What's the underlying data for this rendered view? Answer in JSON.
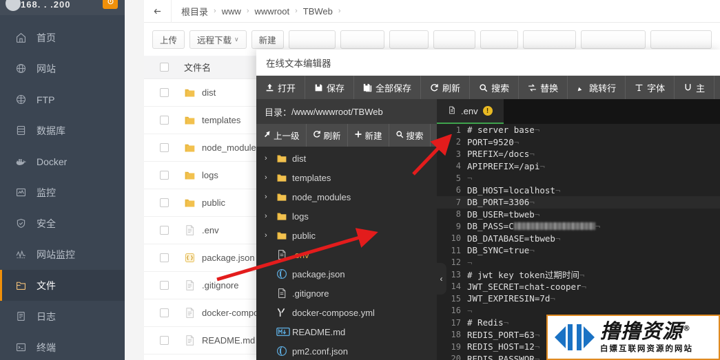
{
  "sidebar": {
    "server_ip": "168.    .      .200",
    "power_icon": "power-icon",
    "items": [
      {
        "label": "首页",
        "icon": "home-icon",
        "active": false
      },
      {
        "label": "网站",
        "icon": "globe-icon",
        "active": false
      },
      {
        "label": "FTP",
        "icon": "ftp-icon",
        "active": false
      },
      {
        "label": "数据库",
        "icon": "database-icon",
        "active": false
      },
      {
        "label": "Docker",
        "icon": "docker-icon",
        "active": false
      },
      {
        "label": "监控",
        "icon": "monitor-icon",
        "active": false
      },
      {
        "label": "安全",
        "icon": "shield-icon",
        "active": false
      },
      {
        "label": "网站监控",
        "icon": "pulse-icon",
        "active": false
      },
      {
        "label": "文件",
        "icon": "folder-icon",
        "active": true
      },
      {
        "label": "日志",
        "icon": "log-icon",
        "active": false
      },
      {
        "label": "终端",
        "icon": "terminal-icon",
        "active": false
      }
    ]
  },
  "filemanager": {
    "back_icon": "back-arrow-icon",
    "breadcrumb": [
      "根目录",
      "www",
      "wwwroot",
      "TBWeb"
    ],
    "breadcrumb_separator": "›",
    "toolbar": [
      {
        "label": "上传",
        "caret": ""
      },
      {
        "label": "远程下载",
        "caret": "∨"
      },
      {
        "label": "新建",
        "caret": ""
      }
    ],
    "table": {
      "header_checkbox": "select-all-checkbox",
      "columns": [
        "文件名"
      ],
      "rows": [
        {
          "name": "dist",
          "type": "folder"
        },
        {
          "name": "templates",
          "type": "folder"
        },
        {
          "name": "node_modules",
          "type": "folder"
        },
        {
          "name": "logs",
          "type": "folder"
        },
        {
          "name": "public",
          "type": "folder"
        },
        {
          "name": ".env",
          "type": "file"
        },
        {
          "name": "package.json",
          "type": "json"
        },
        {
          "name": ".gitignore",
          "type": "file"
        },
        {
          "name": "docker-compose.yml",
          "type": "file"
        },
        {
          "name": "README.md",
          "type": "file"
        }
      ]
    }
  },
  "editor": {
    "title": "在线文本编辑器",
    "toolbar": [
      {
        "label": "打开",
        "icon": "upload-icon"
      },
      {
        "label": "保存",
        "icon": "save-icon"
      },
      {
        "label": "全部保存",
        "icon": "save-all-icon"
      },
      {
        "label": "刷新",
        "icon": "refresh-icon"
      },
      {
        "label": "搜索",
        "icon": "search-icon"
      },
      {
        "label": "替换",
        "icon": "replace-icon"
      },
      {
        "label": "跳转行",
        "icon": "goto-line-icon"
      },
      {
        "label": "字体",
        "icon": "font-icon"
      },
      {
        "label": "主",
        "icon": "theme-icon"
      }
    ],
    "directory_label": "目录：",
    "directory_path": "/www/wwwroot/TBWeb",
    "left_toolbar": [
      {
        "label": "上一级",
        "icon": "up-level-icon"
      },
      {
        "label": "刷新",
        "icon": "refresh-icon"
      },
      {
        "label": "新建",
        "icon": "plus-icon"
      },
      {
        "label": "搜索",
        "icon": "search-icon"
      }
    ],
    "tree": [
      {
        "name": "dist",
        "type": "folder",
        "expandable": true,
        "highlight": false
      },
      {
        "name": "templates",
        "type": "folder",
        "expandable": true,
        "highlight": false
      },
      {
        "name": "node_modules",
        "type": "folder",
        "expandable": true,
        "highlight": false
      },
      {
        "name": "logs",
        "type": "folder",
        "expandable": true,
        "highlight": false
      },
      {
        "name": "public",
        "type": "folder",
        "expandable": true,
        "highlight": false
      },
      {
        "name": ".env",
        "type": "file",
        "expandable": false,
        "highlight": true
      },
      {
        "name": "package.json",
        "type": "json",
        "expandable": false,
        "highlight": false
      },
      {
        "name": ".gitignore",
        "type": "file",
        "expandable": false,
        "highlight": false
      },
      {
        "name": "docker-compose.yml",
        "type": "yml",
        "expandable": false,
        "highlight": false
      },
      {
        "name": "README.md",
        "type": "md",
        "expandable": false,
        "highlight": false
      },
      {
        "name": "pm2.conf.json",
        "type": "json",
        "expandable": false,
        "highlight": false
      }
    ],
    "tab": {
      "label": ".env",
      "icon": "file-icon",
      "badge": "!",
      "active": true
    },
    "collapse_handle": "‹",
    "code_lines": [
      {
        "n": 1,
        "text": "# server base",
        "current": false,
        "redacted": false
      },
      {
        "n": 2,
        "text": "PORT=9520",
        "current": false,
        "redacted": false
      },
      {
        "n": 3,
        "text": "PREFIX=/docs",
        "current": false,
        "redacted": false
      },
      {
        "n": 4,
        "text": "APIPREFIX=/api",
        "current": false,
        "redacted": false
      },
      {
        "n": 5,
        "text": "",
        "current": false,
        "redacted": false
      },
      {
        "n": 6,
        "text": "DB_HOST=localhost",
        "current": false,
        "redacted": false
      },
      {
        "n": 7,
        "text": "DB_PORT=3306",
        "current": true,
        "redacted": false
      },
      {
        "n": 8,
        "text": "DB_USER=tbweb",
        "current": false,
        "redacted": false
      },
      {
        "n": 9,
        "text": "DB_PASS=C",
        "current": false,
        "redacted": true
      },
      {
        "n": 10,
        "text": "DB_DATABASE=tbweb",
        "current": false,
        "redacted": false
      },
      {
        "n": 11,
        "text": "DB_SYNC=true",
        "current": false,
        "redacted": false
      },
      {
        "n": 12,
        "text": "",
        "current": false,
        "redacted": false
      },
      {
        "n": 13,
        "text": "# jwt key token过期时间",
        "current": false,
        "redacted": false
      },
      {
        "n": 14,
        "text": "JWT_SECRET=chat-cooper",
        "current": false,
        "redacted": false
      },
      {
        "n": 15,
        "text": "JWT_EXPIRESIN=7d",
        "current": false,
        "redacted": false
      },
      {
        "n": 16,
        "text": "",
        "current": false,
        "redacted": false
      },
      {
        "n": 17,
        "text": "# Redis",
        "current": false,
        "redacted": false
      },
      {
        "n": 18,
        "text": "REDIS_PORT=63",
        "current": false,
        "redacted": false
      },
      {
        "n": 19,
        "text": "REDIS_HOST=12",
        "current": false,
        "redacted": false
      },
      {
        "n": 20,
        "text": "REDIS_PASSWOR",
        "current": false,
        "redacted": false
      }
    ]
  },
  "watermark": {
    "title": "撸撸资源",
    "registered": "®",
    "subtitle": "白嫖互联网资源的网站",
    "accent": "#e08a20",
    "logo_color": "#1a72c4"
  },
  "annotations": {
    "arrow_color": "#e31c1c",
    "arrow_count": 2
  }
}
